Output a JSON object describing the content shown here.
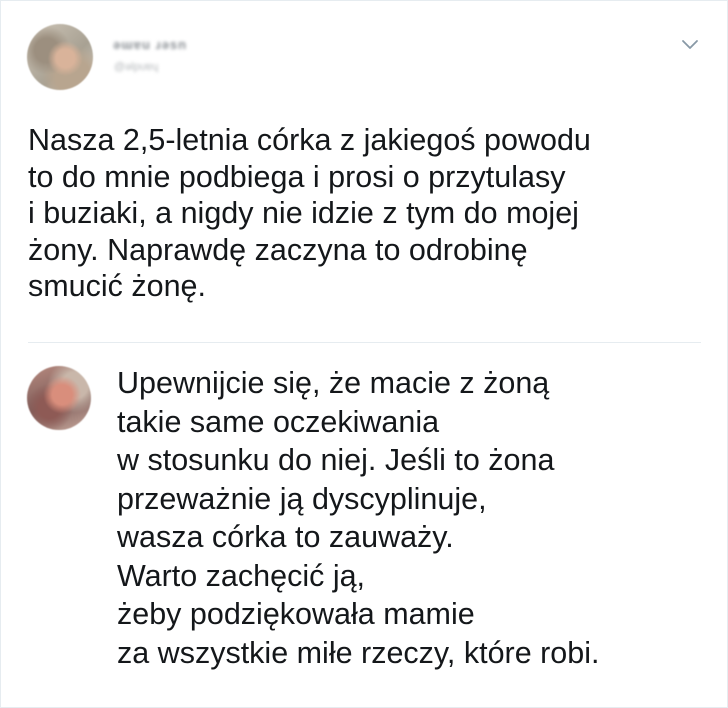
{
  "tweet": {
    "author_name": "ǝɯɐu ɹǝsn",
    "author_handle": "@ǝlpuɐɥ",
    "menu_icon": "chevron-down-icon",
    "lines": [
      "Nasza 2,5-letnia córka z jakiegoś powodu",
      "to do mnie podbiega i prosi o przytulasy",
      "i buziaki, a nigdy nie idzie z tym do mojej",
      "żony. Naprawdę zaczyna to odrobinę",
      "smucić żonę."
    ]
  },
  "reply": {
    "lines": [
      "Upewnijcie się, że macie z żoną",
      "takie same oczekiwania",
      "w stosunku do niej. Jeśli to żona",
      "przeważnie ją dyscyplinuje,",
      "wasza córka to zauważy.",
      "Warto zachęcić ją,",
      "żeby podziękowała mamie",
      "za wszystkie miłe rzeczy, które robi."
    ]
  },
  "colors": {
    "text": "#14171a",
    "divider": "#e6ecf0",
    "chevron": "#8899a6"
  }
}
